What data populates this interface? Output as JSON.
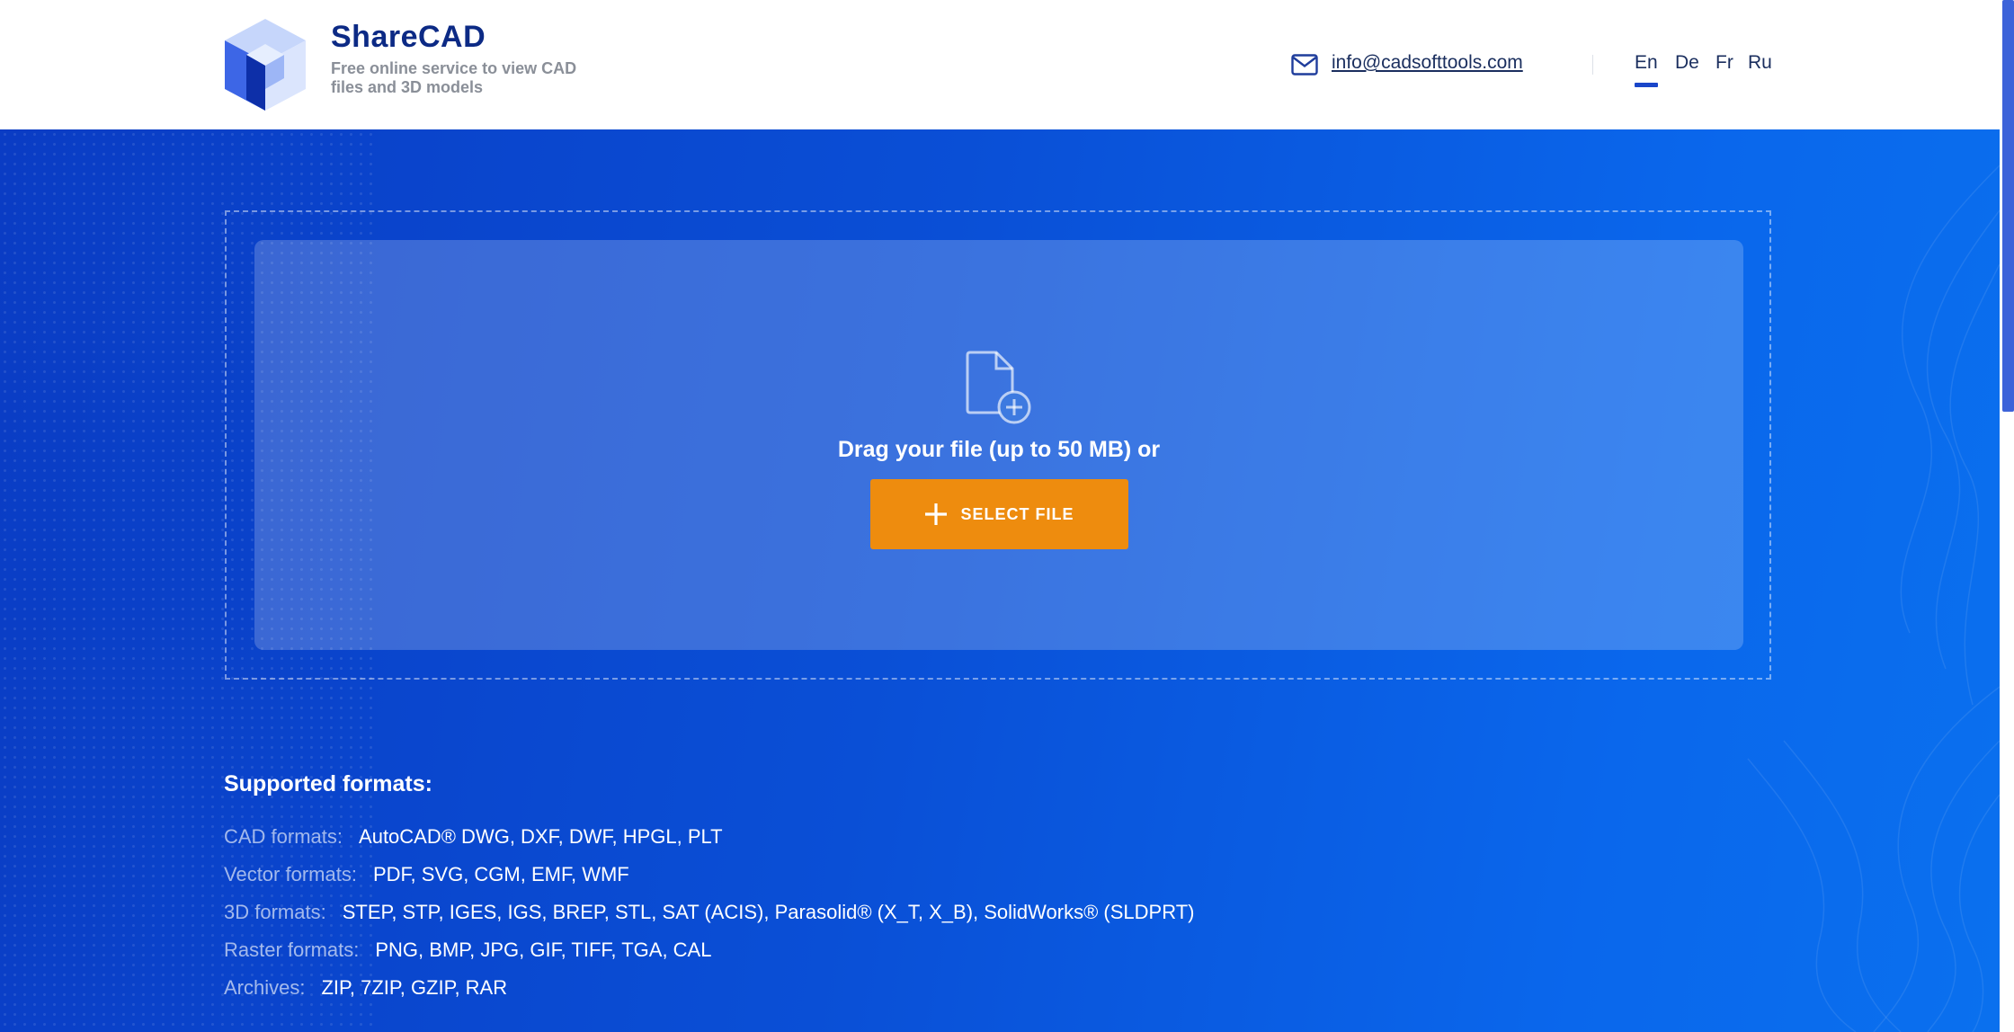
{
  "header": {
    "brand_name": "ShareCAD",
    "tagline": "Free online service to view CAD files and 3D models",
    "email": "info@cadsofttools.com",
    "languages": [
      "En",
      "De",
      "Fr",
      "Ru"
    ],
    "active_language": "En",
    "icons": {
      "logo": "cube-logo-icon",
      "email": "mail-icon"
    }
  },
  "upload": {
    "drag_text": "Drag your file (up to 50 MB) or",
    "button_label": "SELECT FILE",
    "icons": {
      "file": "add-file-icon",
      "button": "plus-icon"
    }
  },
  "formats": {
    "title": "Supported formats:",
    "rows": [
      {
        "label": "CAD formats:",
        "values": "AutoCAD® DWG, DXF, DWF, HPGL, PLT"
      },
      {
        "label": "Vector formats:",
        "values": "PDF, SVG, CGM, EMF, WMF"
      },
      {
        "label": "3D formats:",
        "values": "STEP, STP, IGES, IGS, BREP, STL, SAT (ACIS), Parasolid® (X_T, X_B), SolidWorks® (SLDPRT)"
      },
      {
        "label": "Raster formats:",
        "values": "PNG, BMP, JPG, GIF, TIFF, TGA, CAL"
      },
      {
        "label": "Archives:",
        "values": "ZIP, 7ZIP, GZIP, RAR"
      }
    ]
  },
  "colors": {
    "brand": "#0c2a85",
    "accent_button": "#ee8c0e",
    "hero_start": "#0a3cc4",
    "hero_end": "#0a70ee",
    "active_language_underline": "#1a46c9"
  }
}
